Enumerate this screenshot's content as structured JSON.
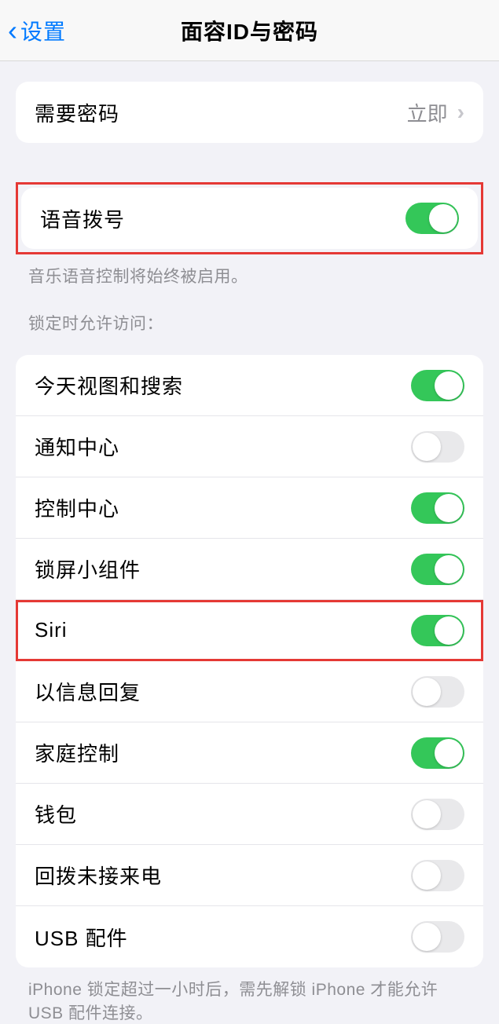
{
  "header": {
    "back_label": "设置",
    "title": "面容ID与密码"
  },
  "passcode_section": {
    "require_passcode": {
      "label": "需要密码",
      "value": "立即"
    }
  },
  "voice_section": {
    "voice_dial": {
      "label": "语音拨号",
      "on": true
    },
    "note": "音乐语音控制将始终被启用。"
  },
  "lock_access": {
    "header": "锁定时允许访问：",
    "items": [
      {
        "label": "今天视图和搜索",
        "on": true
      },
      {
        "label": "通知中心",
        "on": false
      },
      {
        "label": "控制中心",
        "on": true
      },
      {
        "label": "锁屏小组件",
        "on": true
      },
      {
        "label": "Siri",
        "on": true
      },
      {
        "label": "以信息回复",
        "on": false
      },
      {
        "label": "家庭控制",
        "on": true
      },
      {
        "label": "钱包",
        "on": false
      },
      {
        "label": "回拨未接来电",
        "on": false
      },
      {
        "label": "USB 配件",
        "on": false
      }
    ],
    "footer": "iPhone 锁定超过一小时后，需先解锁 iPhone 才能允许 USB 配件连接。"
  }
}
